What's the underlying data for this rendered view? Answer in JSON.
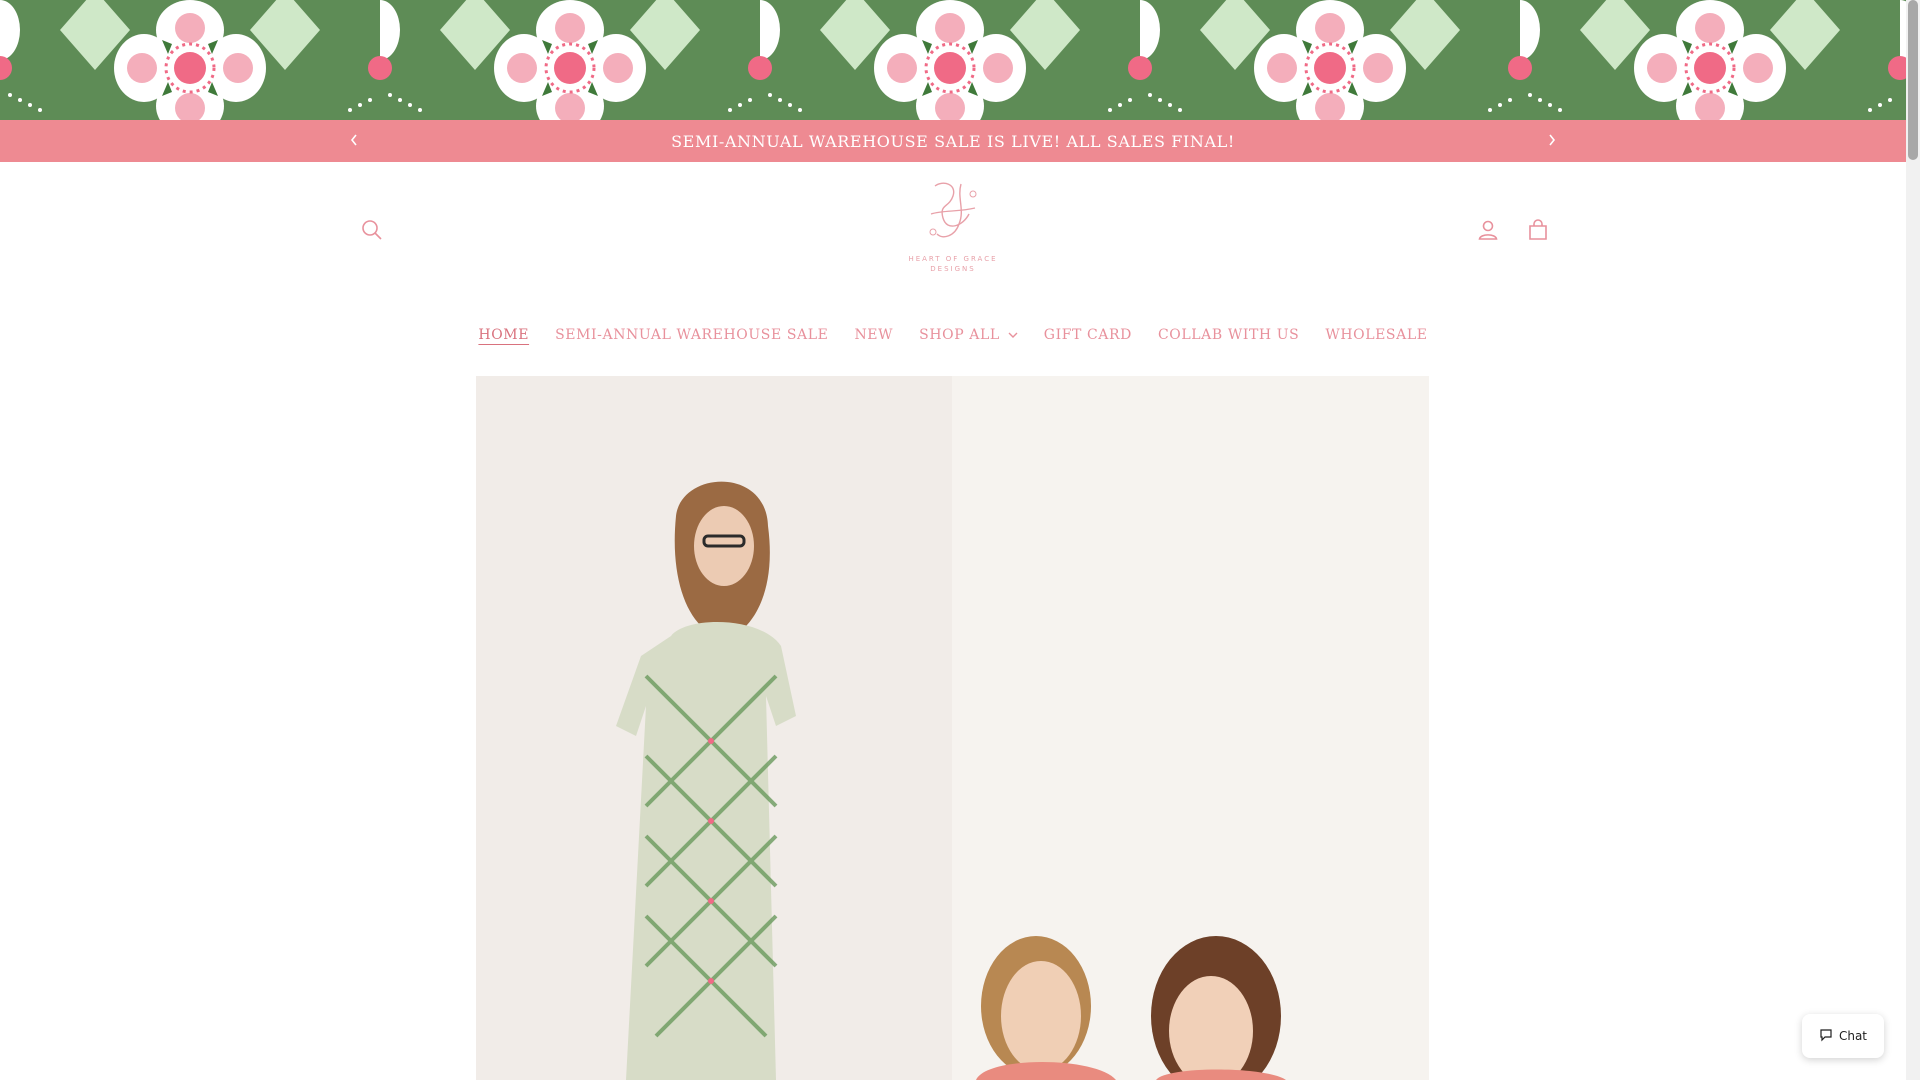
{
  "hero_banner": {
    "image": "green-and-pink-floral-tile-pattern"
  },
  "announcement": {
    "text": "SEMI-ANNUAL WAREHOUSE SALE IS LIVE! ALL SALES FINAL!",
    "prev_icon": "chevron-left-icon",
    "next_icon": "chevron-right-icon"
  },
  "header": {
    "logo_monogram": "H",
    "logo_line1": "HEART OF GRACE",
    "logo_line2": "DESIGNS",
    "search_icon": "search-icon",
    "account_icon": "user-icon",
    "cart_icon": "bag-icon"
  },
  "nav": {
    "items": [
      {
        "label": "HOME"
      },
      {
        "label": "SEMI-ANNUAL WAREHOUSE SALE"
      },
      {
        "label": "NEW"
      },
      {
        "label": "SHOP ALL"
      },
      {
        "label": "GIFT CARD"
      },
      {
        "label": "COLLAB WITH US"
      },
      {
        "label": "WHOLESALE"
      }
    ]
  },
  "hero_image": {
    "image": "models-wearing-patterned-dresses"
  },
  "chat": {
    "label": "Chat",
    "icon": "chat-bubble-icon"
  },
  "colors": {
    "banner_green": "#5e8c56",
    "announcement_pink": "#ee8a92",
    "nav_pink": "#e8919c",
    "flower_pink": "#f4aebb",
    "flower_center": "#f06a86"
  }
}
